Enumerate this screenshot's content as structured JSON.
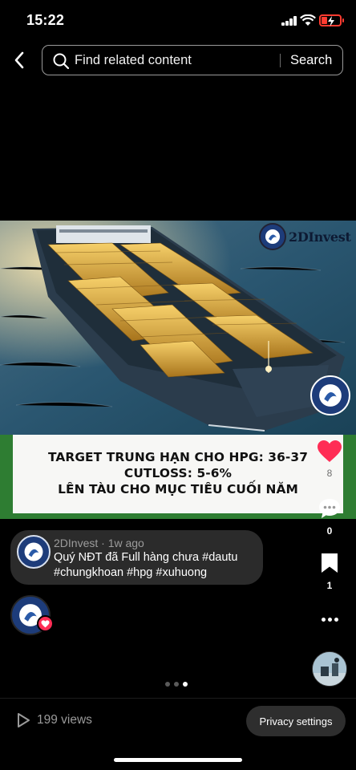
{
  "status_bar": {
    "time": "15:22"
  },
  "search": {
    "placeholder": "Find related content",
    "button_label": "Search"
  },
  "media": {
    "brand_name": "2DInvest",
    "caption_lines": [
      "TARGET TRUNG HẠN CHO HPG: 36-37",
      "CUTLOSS: 5-6%",
      "LÊN TÀU CHO MỤC TIÊU CUỐI NĂM"
    ]
  },
  "actions": {
    "likes": "8",
    "comments": "0",
    "saves": "1"
  },
  "post": {
    "meta": "2DInvest · 1w ago",
    "caption": "Quý NĐT đã Full hàng chưa  #dautu #chungkhoan #hpg #xuhuong"
  },
  "pager": {
    "count": 3,
    "active_index": 2
  },
  "footer": {
    "views": "199 views",
    "privacy_label": "Privacy settings"
  },
  "colors": {
    "like": "#ff2d55",
    "battery": "#ff3b30",
    "caption_band": "#2e7d32"
  },
  "icons": [
    "back-icon",
    "search-icon",
    "heart-icon",
    "comment-icon",
    "bookmark-icon",
    "more-icon",
    "play-icon"
  ]
}
